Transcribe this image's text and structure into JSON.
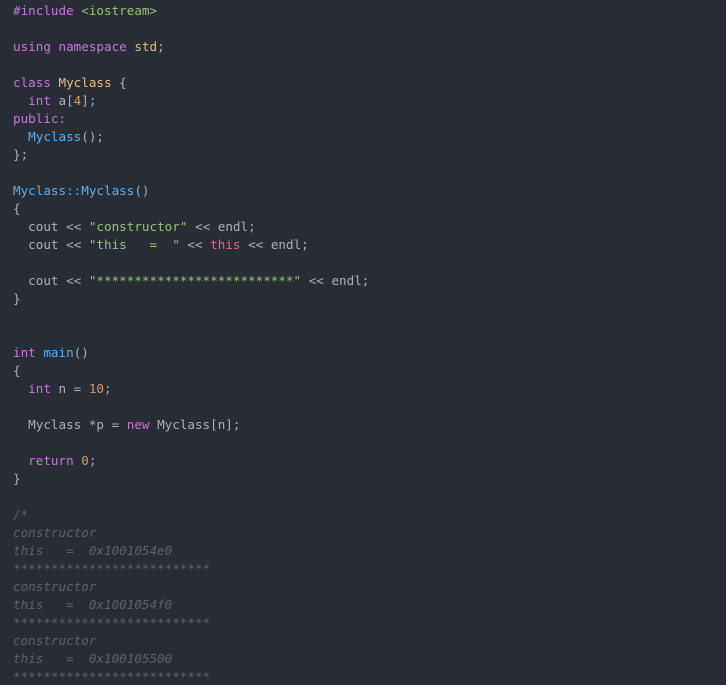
{
  "editor": {
    "background": "#282c34",
    "lines": [
      [
        {
          "t": "#include",
          "c": "preproc"
        },
        {
          "t": " ",
          "c": "plain"
        },
        {
          "t": "<iostream>",
          "c": "include"
        }
      ],
      [],
      [
        {
          "t": "using",
          "c": "keyword"
        },
        {
          "t": " ",
          "c": "plain"
        },
        {
          "t": "namespace",
          "c": "keyword"
        },
        {
          "t": " ",
          "c": "plain"
        },
        {
          "t": "std",
          "c": "std"
        },
        {
          "t": ";",
          "c": "plain"
        }
      ],
      [],
      [
        {
          "t": "class",
          "c": "keyword"
        },
        {
          "t": " ",
          "c": "plain"
        },
        {
          "t": "Myclass",
          "c": "class"
        },
        {
          "t": " {",
          "c": "plain"
        }
      ],
      [
        {
          "t": "  ",
          "c": "plain"
        },
        {
          "t": "int",
          "c": "type"
        },
        {
          "t": " a[",
          "c": "plain"
        },
        {
          "t": "4",
          "c": "number"
        },
        {
          "t": "];",
          "c": "plain"
        }
      ],
      [
        {
          "t": "public:",
          "c": "keyword"
        }
      ],
      [
        {
          "t": "  ",
          "c": "plain"
        },
        {
          "t": "Myclass",
          "c": "func"
        },
        {
          "t": "();",
          "c": "plain"
        }
      ],
      [
        {
          "t": "};",
          "c": "plain"
        }
      ],
      [],
      [
        {
          "t": "Myclass::Myclass",
          "c": "func"
        },
        {
          "t": "()",
          "c": "plain"
        }
      ],
      [
        {
          "t": "{",
          "c": "plain"
        }
      ],
      [
        {
          "t": "  cout << ",
          "c": "plain"
        },
        {
          "t": "\"constructor\"",
          "c": "string"
        },
        {
          "t": " << endl;",
          "c": "plain"
        }
      ],
      [
        {
          "t": "  cout << ",
          "c": "plain"
        },
        {
          "t": "\"this   =  \"",
          "c": "string"
        },
        {
          "t": " << ",
          "c": "plain"
        },
        {
          "t": "this",
          "c": "this"
        },
        {
          "t": " << endl;",
          "c": "plain"
        }
      ],
      [],
      [
        {
          "t": "  cout << ",
          "c": "plain"
        },
        {
          "t": "\"**************************\"",
          "c": "string"
        },
        {
          "t": " << endl;",
          "c": "plain"
        }
      ],
      [
        {
          "t": "}",
          "c": "plain"
        }
      ],
      [],
      [],
      [
        {
          "t": "int",
          "c": "type"
        },
        {
          "t": " ",
          "c": "plain"
        },
        {
          "t": "main",
          "c": "func"
        },
        {
          "t": "()",
          "c": "plain"
        }
      ],
      [
        {
          "t": "{",
          "c": "plain"
        }
      ],
      [
        {
          "t": "  ",
          "c": "plain"
        },
        {
          "t": "int",
          "c": "type"
        },
        {
          "t": " n = ",
          "c": "plain"
        },
        {
          "t": "10",
          "c": "number"
        },
        {
          "t": ";",
          "c": "plain"
        }
      ],
      [],
      [
        {
          "t": "  Myclass *p = ",
          "c": "plain"
        },
        {
          "t": "new",
          "c": "keyword"
        },
        {
          "t": " Myclass[n];",
          "c": "plain"
        }
      ],
      [],
      [
        {
          "t": "  ",
          "c": "plain"
        },
        {
          "t": "return",
          "c": "keyword"
        },
        {
          "t": " ",
          "c": "plain"
        },
        {
          "t": "0",
          "c": "number"
        },
        {
          "t": ";",
          "c": "plain"
        }
      ],
      [
        {
          "t": "}",
          "c": "plain"
        }
      ],
      [],
      [
        {
          "t": "/*",
          "c": "comment"
        }
      ],
      [
        {
          "t": "constructor",
          "c": "comment"
        }
      ],
      [
        {
          "t": "this   =  0x1001054e0",
          "c": "comment"
        }
      ],
      [
        {
          "t": "**************************",
          "c": "comment"
        }
      ],
      [
        {
          "t": "constructor",
          "c": "comment"
        }
      ],
      [
        {
          "t": "this   =  0x1001054f0",
          "c": "comment"
        }
      ],
      [
        {
          "t": "**************************",
          "c": "comment"
        }
      ],
      [
        {
          "t": "constructor",
          "c": "comment"
        }
      ],
      [
        {
          "t": "this   =  0x100105500",
          "c": "comment"
        }
      ],
      [
        {
          "t": "**************************",
          "c": "comment"
        }
      ]
    ]
  }
}
